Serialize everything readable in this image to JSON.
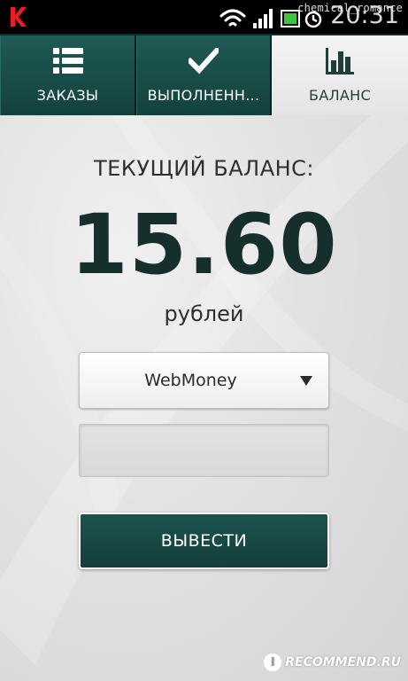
{
  "status_bar": {
    "time": "20:31",
    "watermark": "chemical_romance"
  },
  "tabs": [
    {
      "label": "ЗАКАЗЫ",
      "icon": "list-icon",
      "active": false
    },
    {
      "label": "ВЫПОЛНЕНН...",
      "icon": "checkmark-icon",
      "active": false
    },
    {
      "label": "БАЛАНС",
      "icon": "bar-chart-icon",
      "active": true
    }
  ],
  "balance": {
    "caption": "ТЕКУЩИЙ БАЛАНС:",
    "value": "15.60",
    "unit": "рублей"
  },
  "withdraw_form": {
    "method_selected": "WebMoney",
    "amount_value": "",
    "submit_label": "ВЫВЕСТИ"
  },
  "footer_watermark": {
    "logo_text": "I",
    "text": "RECOMMEND.RU"
  },
  "colors": {
    "tab_bar": "#13413d",
    "active_tab": "#eaeaea",
    "balance_text": "#162e2c",
    "button": "#1b4f4a"
  }
}
